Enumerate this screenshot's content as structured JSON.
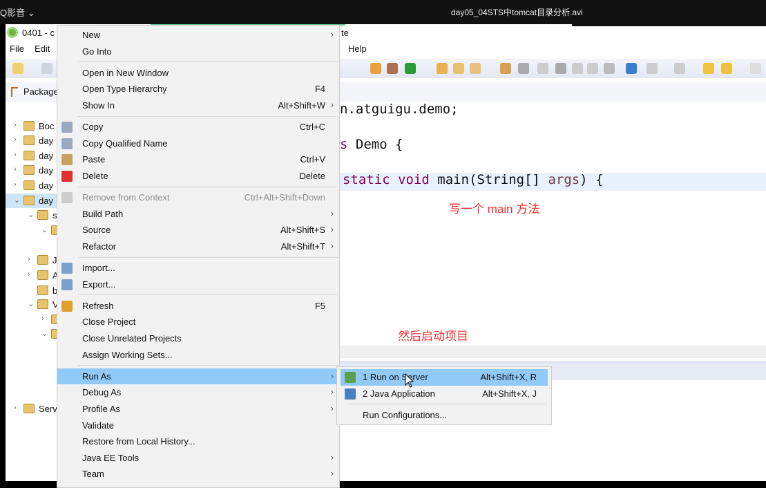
{
  "player": {
    "app": "Q影音 ⌄",
    "title": "day05_04STS中tomcat目录分析.avi"
  },
  "window": {
    "title_left": "0401 - c",
    "title_right": "te"
  },
  "menubar": [
    "File",
    "Edit",
    "Help"
  ],
  "explorer": {
    "tab": "Package",
    "items": [
      {
        "label": "Boc",
        "chev": "›",
        "indent": 0,
        "icon": "web-project-icon"
      },
      {
        "label": "day",
        "chev": "›",
        "indent": 0,
        "icon": "web-project-warning-icon"
      },
      {
        "label": "day",
        "chev": "›",
        "indent": 0,
        "icon": "web-project-icon"
      },
      {
        "label": "day",
        "chev": "›",
        "indent": 0,
        "icon": "web-project-icon"
      },
      {
        "label": "day",
        "chev": "›",
        "indent": 0,
        "icon": "java-project-warning-icon"
      },
      {
        "label": "day",
        "chev": "⌄",
        "indent": 0,
        "icon": "web-project-icon",
        "selected": true
      },
      {
        "label": "s",
        "chev": "⌄",
        "indent": 1,
        "icon": "source-folder-icon"
      },
      {
        "label": "",
        "chev": "⌄",
        "indent": 2,
        "icon": "package-icon"
      },
      {
        "label": "J",
        "chev": "›",
        "indent": 1,
        "icon": "library-icon"
      },
      {
        "label": "A",
        "chev": "›",
        "indent": 1,
        "icon": "library-icon"
      },
      {
        "label": "b",
        "chev": "",
        "indent": 1,
        "icon": "folder-icon"
      },
      {
        "label": "V",
        "chev": "⌄",
        "indent": 1,
        "icon": "folder-icon"
      },
      {
        "label": "",
        "chev": "›",
        "indent": 2,
        "icon": "folder-icon"
      },
      {
        "label": "",
        "chev": "⌄",
        "indent": 2,
        "icon": "folder-icon"
      },
      {
        "label": "",
        "chev": "",
        "indent": 3,
        "icon": "file-icon"
      },
      {
        "label": "",
        "chev": "",
        "indent": 3,
        "icon": "file-icon"
      },
      {
        "label": "Serv",
        "chev": "›",
        "indent": 0,
        "icon": "folder-icon"
      }
    ]
  },
  "editor": {
    "line1": "n.atguigu.demo;",
    "line2_kw": "s",
    "line2_rest": " Demo {",
    "line3_kw": "static void",
    "line3_mid": " main(String[] ",
    "line3_param": "args",
    "line3_end": ") {"
  },
  "annotations": [
    "写一个 main 方法",
    "然后启动项目"
  ],
  "context_menu": [
    {
      "label": "New",
      "arrow": true
    },
    {
      "label": "Go Into"
    },
    {
      "sep": true
    },
    {
      "label": "Open in New Window"
    },
    {
      "label": "Open Type Hierarchy",
      "accel": "F4"
    },
    {
      "label": "Show In",
      "accel": "Alt+Shift+W",
      "arrow": true
    },
    {
      "sep": true
    },
    {
      "label": "Copy",
      "accel": "Ctrl+C",
      "icon": "copy-icon"
    },
    {
      "label": "Copy Qualified Name",
      "icon": "copy-qualified-icon"
    },
    {
      "label": "Paste",
      "accel": "Ctrl+V",
      "icon": "paste-icon"
    },
    {
      "label": "Delete",
      "accel": "Delete",
      "icon": "delete-icon"
    },
    {
      "sep": true
    },
    {
      "label": "Remove from Context",
      "accel": "Ctrl+Alt+Shift+Down",
      "disabled": true,
      "icon": "remove-context-icon"
    },
    {
      "label": "Build Path",
      "arrow": true
    },
    {
      "label": "Source",
      "accel": "Alt+Shift+S",
      "arrow": true
    },
    {
      "label": "Refactor",
      "accel": "Alt+Shift+T",
      "arrow": true
    },
    {
      "sep": true
    },
    {
      "label": "Import...",
      "icon": "import-icon"
    },
    {
      "label": "Export...",
      "icon": "export-icon"
    },
    {
      "sep": true
    },
    {
      "label": "Refresh",
      "accel": "F5",
      "icon": "refresh-icon"
    },
    {
      "label": "Close Project"
    },
    {
      "label": "Close Unrelated Projects"
    },
    {
      "label": "Assign Working Sets..."
    },
    {
      "sep": true
    },
    {
      "label": "Run As",
      "arrow": true,
      "highlighted": true
    },
    {
      "label": "Debug As",
      "arrow": true
    },
    {
      "label": "Profile As",
      "arrow": true
    },
    {
      "label": "Validate"
    },
    {
      "label": "Restore from Local History..."
    },
    {
      "label": "Java EE Tools",
      "arrow": true
    },
    {
      "label": "Team",
      "arrow": true
    }
  ],
  "run_as_submenu": [
    {
      "label": "1 Run on Server",
      "accel": "Alt+Shift+X, R",
      "icon": "run-on-server-icon",
      "highlighted": true
    },
    {
      "label": "2 Java Application",
      "accel": "Alt+Shift+X, J",
      "icon": "java-application-icon"
    },
    {
      "sep": true
    },
    {
      "label": "Run Configurations..."
    }
  ],
  "colors": {
    "highlight": "#91c9f7",
    "annotation": "#f03030",
    "keyword": "#7f0055"
  }
}
